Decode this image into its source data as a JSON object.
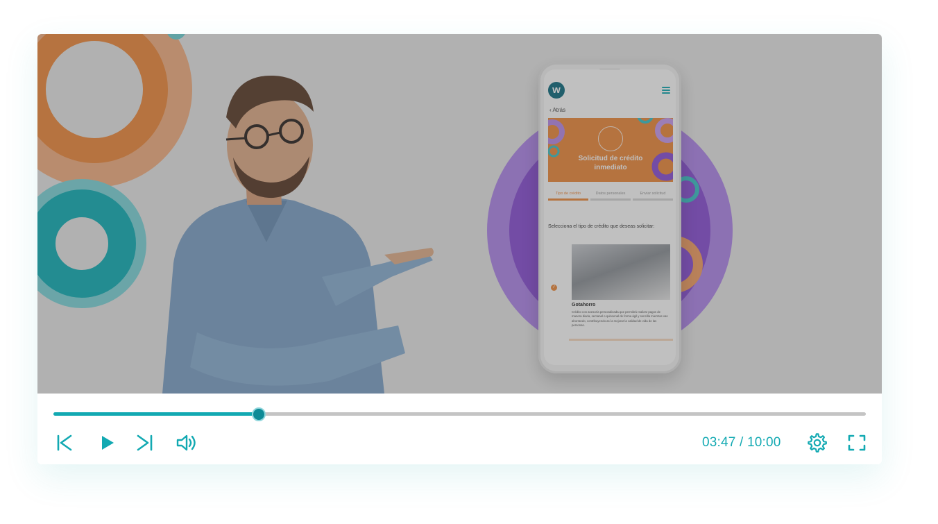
{
  "player": {
    "progress_fraction": 0.2522,
    "time_display": "03:47 / 10:00",
    "accent_color": "#12a9b2",
    "track_color": "#c4c4c4"
  },
  "controls": {
    "previous_icon": "skip-previous-icon",
    "play_icon": "play-icon",
    "next_icon": "skip-next-icon",
    "volume_icon": "volume-icon",
    "settings_icon": "gear-icon",
    "fullscreen_icon": "fullscreen-icon"
  },
  "video_frame": {
    "app": {
      "logo_letter": "w",
      "back_label": "Atrás",
      "hero_title": "Solicitud de crédito inmediato",
      "steps": [
        "Tipo de crédito",
        "Datos personales",
        "Enviar solicitud"
      ],
      "prompt": "Selecciona el tipo de crédito que deseas solicitar:",
      "card_title": "Gotahorro",
      "card_description": "Crédito con asesoría personalizada que permitirá realizar pagos de manera diaria, semanal o quincenal de forma ágil y sencilla mientras vas ahorrando, contribuyendo así a mejorar la calidad de vida de las personas."
    }
  }
}
